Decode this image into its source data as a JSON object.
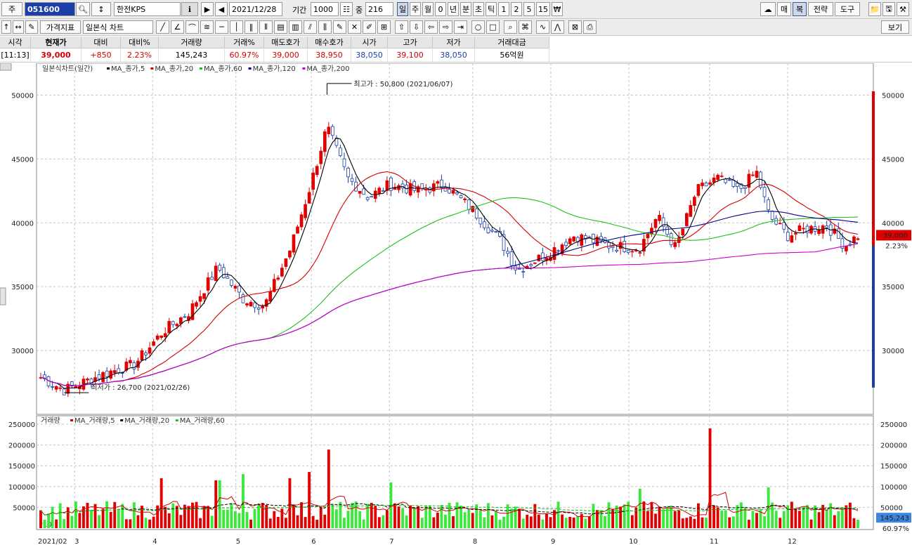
{
  "toolbar1": {
    "type_label": "주",
    "code": "051600",
    "stock_name": "한전KPS",
    "date": "2021/12/28",
    "period_label": "기간",
    "period_value": "1000",
    "middle_label": "중",
    "middle_value": "216",
    "intervals": [
      "일",
      "주",
      "월",
      "0",
      "년",
      "분",
      "초",
      "틱",
      "1",
      "2",
      "5",
      "15",
      "₩"
    ],
    "selected_interval": "일",
    "right_buttons": [
      "매",
      "복",
      "전략",
      "도구"
    ]
  },
  "toolbar2": {
    "indicator_button": "가격지표",
    "chart_type": "일본식 차트",
    "view_button": "보기"
  },
  "quote": {
    "headers": [
      "시각",
      "현재가",
      "대비",
      "대비%",
      "거래량",
      "거래%",
      "매도호가",
      "매수호가",
      "시가",
      "고가",
      "저가",
      "거래대금"
    ],
    "values": [
      "[11:13]",
      "39,000",
      "+850",
      "2.23%",
      "145,243",
      "60.97%",
      "39,000",
      "38,950",
      "38,050",
      "39,100",
      "38,050",
      "56억원"
    ]
  },
  "price_panel": {
    "legend_title": "일본식차트(일간)",
    "ma_legend": [
      {
        "label": "MA_종가,5",
        "color": "#000000"
      },
      {
        "label": "MA_종가,20",
        "color": "#d40000"
      },
      {
        "label": "MA_종가,60",
        "color": "#1ec01e"
      },
      {
        "label": "MA_종가,120",
        "color": "#00008b"
      },
      {
        "label": "MA_종가,200",
        "color": "#cc00cc"
      }
    ],
    "high_annotation": "최고가 : 50,800 (2021/06/07)",
    "low_annotation": "최저가 : 26,700 (2021/02/26)",
    "current_price_tag": "39,000",
    "current_change_tag": "2.23%"
  },
  "volume_panel": {
    "legend_title": "거래량",
    "ma_legend": [
      {
        "label": "MA_거래량,5",
        "color": "#d40000"
      },
      {
        "label": "MA_거래량,20",
        "color": "#000000"
      },
      {
        "label": "MA_거래량,60",
        "color": "#1ec01e"
      }
    ],
    "unit_label": "*10",
    "current_volume_tag": "145,243",
    "current_ratio_tag": "60.97%"
  },
  "colors": {
    "up": "#e00000",
    "down": "#1b3fa6",
    "vol_up": "#e00000",
    "vol_down": "#3ce83c"
  },
  "chart_data": [
    {
      "type": "candlestick",
      "y_ticks": [
        30000,
        35000,
        40000,
        45000,
        50000
      ],
      "ylim": [
        25000,
        52500
      ],
      "x_tick_labels": [
        "2021/02",
        "3",
        "4",
        "5",
        "6",
        "7",
        "8",
        "9",
        "10",
        "11",
        "12"
      ],
      "close_key_points": [
        {
          "date": "2021/02/17",
          "close": 27900
        },
        {
          "date": "2021/02/26",
          "close": 26900
        },
        {
          "date": "2021/03/15",
          "close": 28300
        },
        {
          "date": "2021/03/25",
          "close": 28900
        },
        {
          "date": "2021/04/05",
          "close": 31500
        },
        {
          "date": "2021/04/15",
          "close": 33000
        },
        {
          "date": "2021/04/26",
          "close": 36500
        },
        {
          "date": "2021/05/06",
          "close": 34000
        },
        {
          "date": "2021/05/14",
          "close": 33500
        },
        {
          "date": "2021/05/24",
          "close": 38000
        },
        {
          "date": "2021/05/31",
          "close": 42500
        },
        {
          "date": "2021/06/07",
          "close": 47500
        },
        {
          "date": "2021/06/15",
          "close": 43500
        },
        {
          "date": "2021/06/23",
          "close": 42000
        },
        {
          "date": "2021/07/01",
          "close": 43000
        },
        {
          "date": "2021/07/12",
          "close": 42500
        },
        {
          "date": "2021/07/22",
          "close": 43000
        },
        {
          "date": "2021/08/02",
          "close": 41000
        },
        {
          "date": "2021/08/13",
          "close": 38500
        },
        {
          "date": "2021/08/19",
          "close": 36300
        },
        {
          "date": "2021/08/30",
          "close": 37500
        },
        {
          "date": "2021/09/10",
          "close": 39000
        },
        {
          "date": "2021/09/24",
          "close": 38200
        },
        {
          "date": "2021/10/05",
          "close": 38000
        },
        {
          "date": "2021/10/12",
          "close": 40500
        },
        {
          "date": "2021/10/19",
          "close": 38000
        },
        {
          "date": "2021/10/27",
          "close": 42500
        },
        {
          "date": "2021/11/04",
          "close": 43500
        },
        {
          "date": "2021/11/12",
          "close": 42500
        },
        {
          "date": "2021/11/19",
          "close": 44000
        },
        {
          "date": "2021/11/24",
          "close": 40500
        },
        {
          "date": "2021/12/01",
          "close": 39000
        },
        {
          "date": "2021/12/08",
          "close": 39500
        },
        {
          "date": "2021/12/16",
          "close": 39800
        },
        {
          "date": "2021/12/23",
          "close": 38200
        },
        {
          "date": "2021/12/28",
          "close": 39000
        }
      ],
      "ma_endpoints": {
        "MA_종가,5": {
          "2021/12/28": 38600
        },
        "MA_종가,20": {
          "2021/02/17": 28300,
          "2021/12/28": 39300
        },
        "MA_종가,60": {
          "2021/02/17": 28800,
          "2021/12/28": 41300
        },
        "MA_종가,120": {
          "2021/02/17": 28500,
          "2021/12/28": 40700
        },
        "MA_종가,200": {
          "2021/02/17": 29200,
          "2021/12/28": 39300
        }
      },
      "high": {
        "date": "2021/06/07",
        "value": 50800
      },
      "low": {
        "date": "2021/02/26",
        "value": 26700
      }
    },
    {
      "type": "bar",
      "name": "거래량",
      "y_ticks": [
        50000,
        100000,
        150000,
        200000,
        250000
      ],
      "ylim": [
        0,
        250000
      ],
      "volume_key_points": [
        {
          "date": "2021/04/05",
          "volume": 120000
        },
        {
          "date": "2021/04/26",
          "volume": 115000
        },
        {
          "date": "2021/05/06",
          "volume": 130000
        },
        {
          "date": "2021/05/24",
          "volume": 120000
        },
        {
          "date": "2021/05/31",
          "volume": 135000
        },
        {
          "date": "2021/06/07",
          "volume": 189000
        },
        {
          "date": "2021/07/01",
          "volume": 110000
        },
        {
          "date": "2021/10/05",
          "volume": 95000
        },
        {
          "date": "2021/11/01",
          "volume": 240000
        },
        {
          "date": "2021/11/24",
          "volume": 98000
        },
        {
          "date": "2021/12/28",
          "volume": 20000
        }
      ]
    }
  ]
}
